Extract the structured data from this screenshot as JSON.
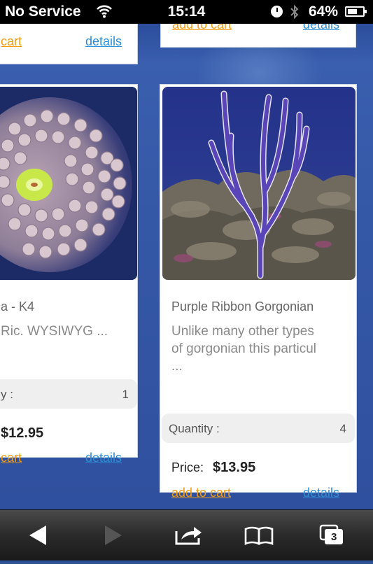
{
  "status_bar": {
    "carrier": "No Service",
    "time": "15:14",
    "battery_percent": "64%",
    "battery_level": 0.64
  },
  "cards": {
    "top_left": {
      "add_to_cart": "cart",
      "details": "details"
    },
    "top_right": {
      "add_to_cart": "add to cart",
      "details": "details"
    },
    "left": {
      "name": "a - K4",
      "description": "Ric. WYSIWYG ...",
      "quantity_label": "y :",
      "quantity_value": "1",
      "price_amount": "$12.95",
      "add_to_cart": "cart",
      "details": "details"
    },
    "right": {
      "name": "Purple Ribbon Gorgonian",
      "description_line1": "Unlike many other types",
      "description_line2": "of gorgonian this particul",
      "description_line3": "...",
      "quantity_label": "Quantity :",
      "quantity_value": "4",
      "price_label": "Price:",
      "price_amount": "$13.95",
      "add_to_cart": "add to cart",
      "details": "details"
    }
  },
  "toolbar": {
    "tabs_count": "3"
  },
  "icons": {
    "back": "back-arrow-icon",
    "forward": "forward-arrow-icon",
    "share": "share-icon",
    "bookmarks": "bookmarks-book-icon",
    "tabs": "tabs-icon"
  }
}
